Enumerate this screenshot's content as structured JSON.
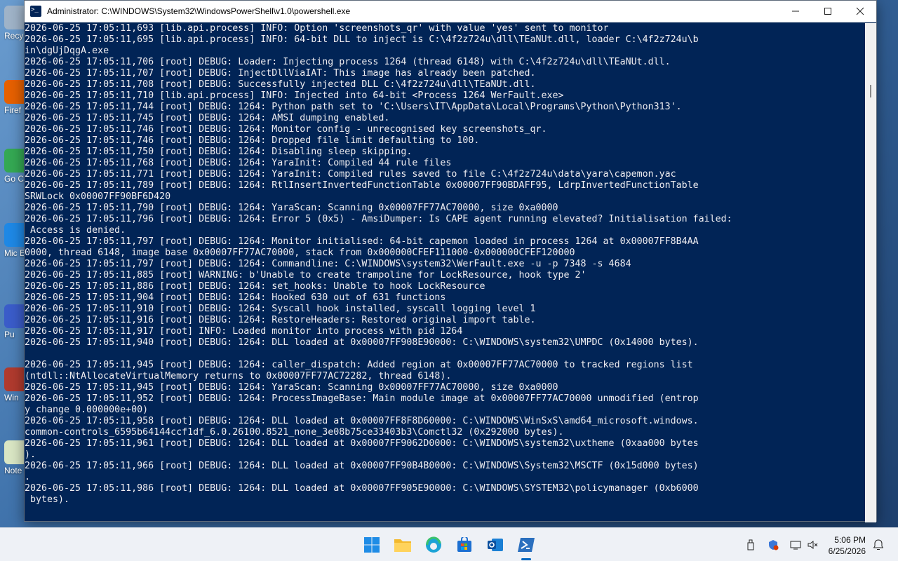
{
  "desktop_icons": [
    {
      "label": "Recy",
      "color": "#9fb3c8",
      "icon": "recycle-bin-icon"
    },
    {
      "label": "Firef",
      "color": "#e66000",
      "icon": "firefox-icon"
    },
    {
      "label": "Go Chr",
      "color": "#34a853",
      "icon": "chrome-icon"
    },
    {
      "label": "Mic Ed",
      "color": "#1e88e5",
      "icon": "edge-icon"
    },
    {
      "label": "Pu",
      "color": "#3a5cc9",
      "icon": "shortcut-icon"
    },
    {
      "label": "Win",
      "color": "#b03a2e",
      "icon": "winrar-icon"
    },
    {
      "label": "Note",
      "color": "#d9e6c4",
      "icon": "notepad-icon"
    }
  ],
  "window": {
    "title": "Administrator: C:\\WINDOWS\\System32\\WindowsPowerShell\\v1.0\\powershell.exe",
    "buttons": [
      "minimize",
      "maximize",
      "close"
    ]
  },
  "console_lines": [
    "2026-06-25 17:05:11,693 [lib.api.process] INFO: Option 'screenshots_qr' with value 'yes' sent to monitor",
    "2026-06-25 17:05:11,695 [lib.api.process] INFO: 64-bit DLL to inject is C:\\4f2z724u\\dll\\TEaNUt.dll, loader C:\\4f2z724u\\b",
    "in\\dgUjDqgA.exe",
    "2026-06-25 17:05:11,706 [root] DEBUG: Loader: Injecting process 1264 (thread 6148) with C:\\4f2z724u\\dll\\TEaNUt.dll.",
    "2026-06-25 17:05:11,707 [root] DEBUG: InjectDllViaIAT: This image has already been patched.",
    "2026-06-25 17:05:11,708 [root] DEBUG: Successfully injected DLL C:\\4f2z724u\\dll\\TEaNUt.dll.",
    "2026-06-25 17:05:11,710 [lib.api.process] INFO: Injected into 64-bit <Process 1264 WerFault.exe>",
    "2026-06-25 17:05:11,744 [root] DEBUG: 1264: Python path set to 'C:\\Users\\IT\\AppData\\Local\\Programs\\Python\\Python313'.",
    "2026-06-25 17:05:11,745 [root] DEBUG: 1264: AMSI dumping enabled.",
    "2026-06-25 17:05:11,746 [root] DEBUG: 1264: Monitor config - unrecognised key screenshots_qr.",
    "2026-06-25 17:05:11,746 [root] DEBUG: 1264: Dropped file limit defaulting to 100.",
    "2026-06-25 17:05:11,750 [root] DEBUG: 1264: Disabling sleep skipping.",
    "2026-06-25 17:05:11,768 [root] DEBUG: 1264: YaraInit: Compiled 44 rule files",
    "2026-06-25 17:05:11,771 [root] DEBUG: 1264: YaraInit: Compiled rules saved to file C:\\4f2z724u\\data\\yara\\capemon.yac",
    "2026-06-25 17:05:11,789 [root] DEBUG: 1264: RtlInsertInvertedFunctionTable 0x00007FF90BDAFF95, LdrpInvertedFunctionTable",
    "SRWLock 0x00007FF90BF6D420",
    "2026-06-25 17:05:11,790 [root] DEBUG: 1264: YaraScan: Scanning 0x00007FF77AC70000, size 0xa0000",
    "2026-06-25 17:05:11,796 [root] DEBUG: 1264: Error 5 (0x5) - AmsiDumper: Is CAPE agent running elevated? Initialisation failed:",
    " Access is denied.",
    "2026-06-25 17:05:11,797 [root] DEBUG: 1264: Monitor initialised: 64-bit capemon loaded in process 1264 at 0x00007FF8B4AA",
    "0000, thread 6148, image base 0x00007FF77AC70000, stack from 0x000000CFEF111000-0x000000CFEF120000",
    "2026-06-25 17:05:11,797 [root] DEBUG: 1264: Commandline: C:\\WINDOWS\\system32\\WerFault.exe -u -p 7348 -s 4684",
    "2026-06-25 17:05:11,885 [root] WARNING: b'Unable to create trampoline for LockResource, hook type 2'",
    "2026-06-25 17:05:11,886 [root] DEBUG: 1264: set_hooks: Unable to hook LockResource",
    "2026-06-25 17:05:11,904 [root] DEBUG: 1264: Hooked 630 out of 631 functions",
    "2026-06-25 17:05:11,910 [root] DEBUG: 1264: Syscall hook installed, syscall logging level 1",
    "2026-06-25 17:05:11,916 [root] DEBUG: 1264: RestoreHeaders: Restored original import table.",
    "2026-06-25 17:05:11,917 [root] INFO: Loaded monitor into process with pid 1264",
    "2026-06-25 17:05:11,940 [root] DEBUG: 1264: DLL loaded at 0x00007FF908E90000: C:\\WINDOWS\\system32\\UMPDC (0x14000 bytes).",
    "",
    "2026-06-25 17:05:11,945 [root] DEBUG: 1264: caller_dispatch: Added region at 0x00007FF77AC70000 to tracked regions list",
    "(ntdll::NtAllocateVirtualMemory returns to 0x00007FF77AC72282, thread 6148).",
    "2026-06-25 17:05:11,945 [root] DEBUG: 1264: YaraScan: Scanning 0x00007FF77AC70000, size 0xa0000",
    "2026-06-25 17:05:11,952 [root] DEBUG: 1264: ProcessImageBase: Main module image at 0x00007FF77AC70000 unmodified (entrop",
    "y change 0.000000e+00)",
    "2026-06-25 17:05:11,958 [root] DEBUG: 1264: DLL loaded at 0x00007FF8F8D60000: C:\\WINDOWS\\WinSxS\\amd64_microsoft.windows.",
    "common-controls_6595b64144ccf1df_6.0.26100.8521_none_3e08b75ce33403b3\\Comctl32 (0x292000 bytes).",
    "2026-06-25 17:05:11,961 [root] DEBUG: 1264: DLL loaded at 0x00007FF9062D0000: C:\\WINDOWS\\system32\\uxtheme (0xaa000 bytes",
    ").",
    "2026-06-25 17:05:11,966 [root] DEBUG: 1264: DLL loaded at 0x00007FF90B4B0000: C:\\WINDOWS\\System32\\MSCTF (0x15d000 bytes)",
    ".",
    "2026-06-25 17:05:11,986 [root] DEBUG: 1264: DLL loaded at 0x00007FF905E90000: C:\\WINDOWS\\SYSTEM32\\policymanager (0xb6000",
    " bytes)."
  ],
  "taskbar": {
    "apps": [
      {
        "name": "start-button",
        "icon": "windows-logo-icon"
      },
      {
        "name": "file-explorer",
        "icon": "folder-icon"
      },
      {
        "name": "edge",
        "icon": "edge-icon"
      },
      {
        "name": "store",
        "icon": "store-icon"
      },
      {
        "name": "outlook",
        "icon": "outlook-icon"
      },
      {
        "name": "powershell",
        "icon": "powershell-icon",
        "active": true
      }
    ],
    "time": "5:06 PM",
    "date": "6/25/2026"
  }
}
